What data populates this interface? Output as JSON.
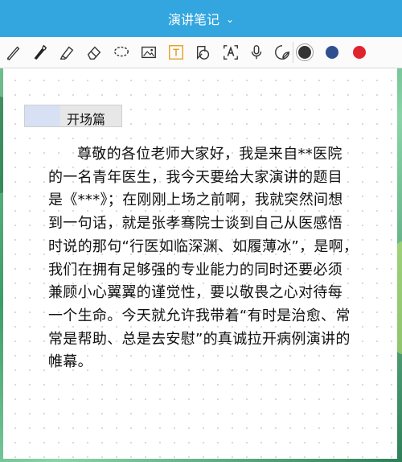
{
  "window": {
    "title": "演讲笔记"
  },
  "toolbar": {
    "tools": [
      "pencil-icon",
      "pen-icon",
      "highlighter-icon",
      "eraser-icon",
      "lasso-icon",
      "image-icon",
      "text-icon",
      "shapes-icon",
      "text-recognition-icon",
      "microphone-icon",
      "sticker-icon"
    ],
    "colors": [
      "#333333",
      "#2f4f8f",
      "#e0242e"
    ],
    "selected_color": "#333333"
  },
  "note": {
    "heading": "开场篇",
    "lines": [
      "尊敬的各位老师大家好，我是来自**医院",
      "的一名青年医生，我今天要给大家演讲的题目",
      "是《***》；在刚刚上场之前啊，我就突然间想",
      "到一句话，就是张孝骞院士谈到自己从医感悟",
      "时说的那句“行医如临深渊、如履薄冰”，是啊，",
      "我们在拥有足够强的专业能力的同时还要必须",
      "兼顾小心翼翼的谨觉性，要以敬畏之心对待每",
      "一个生命。今天就允许我带着“有时是治愈、常",
      "常是帮助、总是去安慰”的真诚拉开病例演讲的",
      "帷幕。"
    ]
  }
}
